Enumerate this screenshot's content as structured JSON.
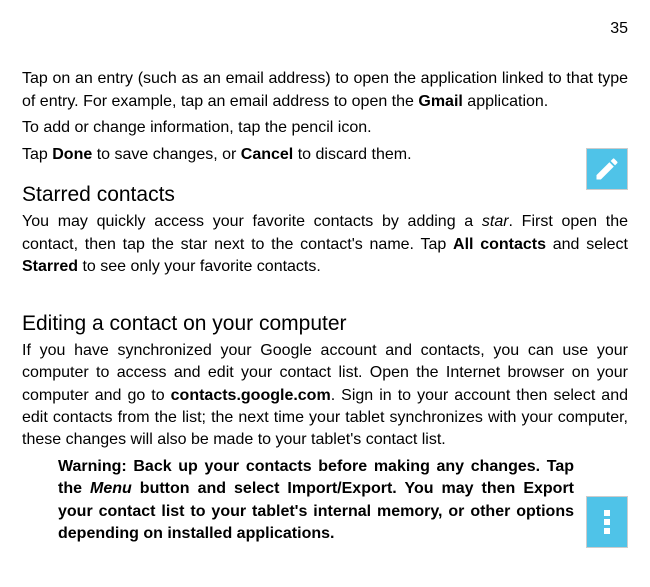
{
  "pageNumber": "35",
  "para1": "Tap on an entry (such as an email address) to open the application linked to that type of entry. For example, tap an email address to open the ",
  "para1_bold": "Gmail",
  "para1_end": " application.",
  "para2": "To add or change information, tap the pencil icon.",
  "para3_pre": "Tap ",
  "para3_done": "Done",
  "para3_mid": " to save changes, or ",
  "para3_cancel": "Cancel",
  "para3_end": " to discard them.",
  "heading1": "Starred contacts",
  "starred_pre": "You may quickly access your favorite contacts by adding a ",
  "starred_star": "star",
  "starred_mid": ". First open the contact, then tap the star next to the contact's name. Tap ",
  "starred_all": "All contacts",
  "starred_mid2": "  and select ",
  "starred_starred": "Starred",
  "starred_end": " to see only your favorite contacts.",
  "heading2": "Editing a contact on your computer",
  "editing_pre": "If you have synchronized your Google account and contacts, you can use your computer to access and edit your contact list. Open the Internet browser on your computer and go to ",
  "editing_url": "contacts.google.com",
  "editing_end": ". Sign in to your account then select and edit contacts from the list; the next time your tablet synchronizes with your computer, these changes will also be made to your tablet's contact list.",
  "warning_pre": "Warning: Back up your contacts before making any changes. Tap the ",
  "warning_menu": "Menu",
  "warning_end": " button and select Import/Export. You may then Export your contact list to your tablet's internal memory, or other options depending on installed applications."
}
